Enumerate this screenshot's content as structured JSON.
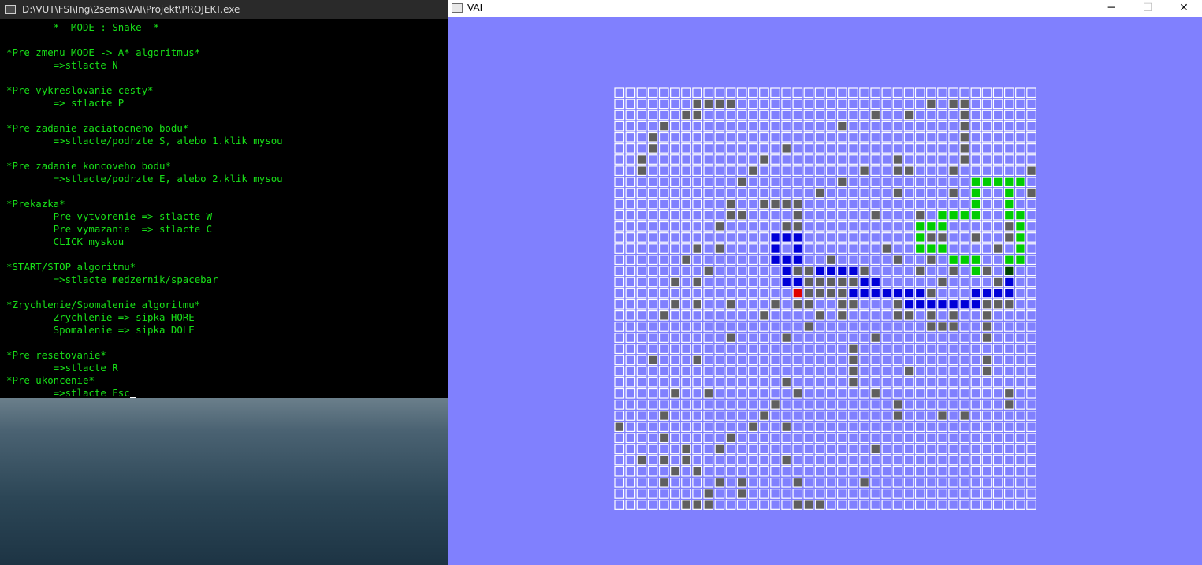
{
  "console": {
    "title": "D:\\VUT\\FSI\\Ing\\2sems\\VAI\\Projekt\\PROJEKT.exe",
    "lines": [
      "        *  MODE : Snake  *",
      "",
      "*Pre zmenu MODE -> A* algoritmus*",
      "        =>stlacte N",
      "",
      "*Pre vykreslovanie cesty*",
      "        => stlacte P",
      "",
      "*Pre zadanie zaciatocneho bodu*",
      "        =>stlacte/podrzte S, alebo 1.klik mysou",
      "",
      "*Pre zadanie koncoveho bodu*",
      "        =>stlacte/podrzte E, alebo 2.klik mysou",
      "",
      "*Prekazka*",
      "        Pre vytvorenie => stlacte W",
      "        Pre vymazanie  => stlacte C",
      "        CLICK myskou",
      "",
      "*START/STOP algoritmu*",
      "        =>stlacte medzernik/spacebar",
      "",
      "*Zrychlenie/Spomalenie algoritmu*",
      "        Zrychlenie => sipka HORE",
      "        Spomalenie => sipka DOLE",
      "",
      "*Pre resetovanie*",
      "        =>stlacte R",
      "*Pre ukoncenie*",
      "        =>stlacte Esc"
    ]
  },
  "vai_window": {
    "title": "VAI",
    "minimize_glyph": "─",
    "maximize_glyph": "☐",
    "close_glyph": "✕"
  },
  "colors": {
    "console_bg": "#000000",
    "console_text": "#18e018",
    "window_bg": "#8080fe",
    "cell_empty": "#8080fe",
    "cell_border": "#ffffff",
    "obstacle": "#5f5f5f",
    "snake_blue": "#0000d8",
    "snake_green": "#00cc00",
    "start": "#e00000",
    "goal": "#004400"
  },
  "grid": {
    "cols": 38,
    "rows": 38,
    "obstacles": [
      [
        1,
        7
      ],
      [
        1,
        8
      ],
      [
        1,
        9
      ],
      [
        1,
        10
      ],
      [
        1,
        28
      ],
      [
        1,
        30
      ],
      [
        1,
        31
      ],
      [
        2,
        6
      ],
      [
        2,
        7
      ],
      [
        2,
        23
      ],
      [
        2,
        26
      ],
      [
        2,
        31
      ],
      [
        3,
        4
      ],
      [
        3,
        20
      ],
      [
        3,
        31
      ],
      [
        4,
        3
      ],
      [
        4,
        31
      ],
      [
        5,
        3
      ],
      [
        5,
        15
      ],
      [
        5,
        31
      ],
      [
        6,
        2
      ],
      [
        6,
        13
      ],
      [
        6,
        25
      ],
      [
        6,
        31
      ],
      [
        7,
        2
      ],
      [
        7,
        12
      ],
      [
        7,
        22
      ],
      [
        7,
        25
      ],
      [
        7,
        26
      ],
      [
        7,
        30
      ],
      [
        7,
        37
      ],
      [
        8,
        11
      ],
      [
        8,
        20
      ],
      [
        9,
        18
      ],
      [
        9,
        25
      ],
      [
        9,
        30
      ],
      [
        9,
        37
      ],
      [
        10,
        10
      ],
      [
        10,
        13
      ],
      [
        10,
        14
      ],
      [
        10,
        15
      ],
      [
        10,
        16
      ],
      [
        11,
        10
      ],
      [
        11,
        11
      ],
      [
        11,
        16
      ],
      [
        11,
        23
      ],
      [
        11,
        27
      ],
      [
        11,
        30
      ],
      [
        12,
        9
      ],
      [
        12,
        15
      ],
      [
        12,
        16
      ],
      [
        12,
        27
      ],
      [
        12,
        28
      ],
      [
        12,
        29
      ],
      [
        12,
        35
      ],
      [
        13,
        27
      ],
      [
        13,
        28
      ],
      [
        13,
        29
      ],
      [
        13,
        32
      ],
      [
        13,
        35
      ],
      [
        14,
        7
      ],
      [
        14,
        9
      ],
      [
        14,
        16
      ],
      [
        14,
        24
      ],
      [
        14,
        29
      ],
      [
        14,
        34
      ],
      [
        15,
        6
      ],
      [
        15,
        15
      ],
      [
        15,
        19
      ],
      [
        15,
        25
      ],
      [
        15,
        28
      ],
      [
        15,
        35
      ],
      [
        16,
        8
      ],
      [
        16,
        16
      ],
      [
        16,
        17
      ],
      [
        16,
        22
      ],
      [
        16,
        27
      ],
      [
        16,
        30
      ],
      [
        16,
        33
      ],
      [
        17,
        5
      ],
      [
        17,
        7
      ],
      [
        17,
        15
      ],
      [
        17,
        17
      ],
      [
        17,
        18
      ],
      [
        17,
        19
      ],
      [
        17,
        20
      ],
      [
        17,
        21
      ],
      [
        17,
        29
      ],
      [
        17,
        34
      ],
      [
        18,
        16
      ],
      [
        18,
        17
      ],
      [
        18,
        18
      ],
      [
        18,
        19
      ],
      [
        18,
        20
      ],
      [
        18,
        28
      ],
      [
        19,
        5
      ],
      [
        19,
        7
      ],
      [
        19,
        10
      ],
      [
        19,
        14
      ],
      [
        19,
        16
      ],
      [
        19,
        17
      ],
      [
        19,
        20
      ],
      [
        19,
        21
      ],
      [
        19,
        25
      ],
      [
        19,
        26
      ],
      [
        19,
        27
      ],
      [
        19,
        29
      ],
      [
        19,
        33
      ],
      [
        19,
        34
      ],
      [
        19,
        35
      ],
      [
        20,
        4
      ],
      [
        20,
        13
      ],
      [
        20,
        18
      ],
      [
        20,
        20
      ],
      [
        20,
        25
      ],
      [
        20,
        26
      ],
      [
        20,
        28
      ],
      [
        20,
        30
      ],
      [
        20,
        33
      ],
      [
        21,
        17
      ],
      [
        21,
        28
      ],
      [
        21,
        29
      ],
      [
        21,
        30
      ],
      [
        21,
        33
      ],
      [
        22,
        10
      ],
      [
        22,
        15
      ],
      [
        22,
        23
      ],
      [
        22,
        33
      ],
      [
        23,
        21
      ],
      [
        24,
        3
      ],
      [
        24,
        7
      ],
      [
        24,
        21
      ],
      [
        24,
        33
      ],
      [
        25,
        21
      ],
      [
        25,
        26
      ],
      [
        25,
        33
      ],
      [
        26,
        15
      ],
      [
        26,
        21
      ],
      [
        27,
        5
      ],
      [
        27,
        8
      ],
      [
        27,
        16
      ],
      [
        27,
        23
      ],
      [
        27,
        35
      ],
      [
        28,
        14
      ],
      [
        28,
        25
      ],
      [
        28,
        35
      ],
      [
        29,
        4
      ],
      [
        29,
        13
      ],
      [
        29,
        25
      ],
      [
        29,
        29
      ],
      [
        29,
        31
      ],
      [
        30,
        0
      ],
      [
        30,
        12
      ],
      [
        30,
        15
      ],
      [
        31,
        4
      ],
      [
        31,
        10
      ],
      [
        32,
        6
      ],
      [
        32,
        9
      ],
      [
        32,
        23
      ],
      [
        33,
        2
      ],
      [
        33,
        4
      ],
      [
        33,
        6
      ],
      [
        33,
        15
      ],
      [
        34,
        5
      ],
      [
        34,
        7
      ],
      [
        35,
        4
      ],
      [
        35,
        9
      ],
      [
        35,
        11
      ],
      [
        35,
        16
      ],
      [
        35,
        22
      ],
      [
        36,
        8
      ],
      [
        36,
        11
      ],
      [
        37,
        16
      ],
      [
        37,
        17
      ],
      [
        37,
        18
      ],
      [
        37,
        6
      ],
      [
        37,
        7
      ],
      [
        37,
        8
      ]
    ],
    "blue_path": [
      [
        13,
        14
      ],
      [
        13,
        15
      ],
      [
        13,
        16
      ],
      [
        14,
        14
      ],
      [
        14,
        16
      ],
      [
        15,
        14
      ],
      [
        15,
        15
      ],
      [
        15,
        16
      ],
      [
        16,
        15
      ],
      [
        16,
        18
      ],
      [
        16,
        19
      ],
      [
        16,
        20
      ],
      [
        16,
        21
      ],
      [
        17,
        15
      ],
      [
        17,
        16
      ],
      [
        17,
        22
      ],
      [
        17,
        23
      ],
      [
        18,
        21
      ],
      [
        18,
        22
      ],
      [
        18,
        23
      ],
      [
        18,
        24
      ],
      [
        18,
        25
      ],
      [
        18,
        26
      ],
      [
        18,
        27
      ],
      [
        19,
        26
      ],
      [
        19,
        27
      ],
      [
        19,
        28
      ],
      [
        19,
        29
      ],
      [
        19,
        30
      ],
      [
        19,
        31
      ],
      [
        19,
        32
      ],
      [
        18,
        32
      ],
      [
        18,
        33
      ],
      [
        18,
        34
      ],
      [
        18,
        35
      ],
      [
        17,
        35
      ]
    ],
    "green_path": [
      [
        8,
        32
      ],
      [
        8,
        33
      ],
      [
        8,
        34
      ],
      [
        8,
        35
      ],
      [
        8,
        36
      ],
      [
        9,
        32
      ],
      [
        9,
        35
      ],
      [
        10,
        32
      ],
      [
        10,
        35
      ],
      [
        11,
        29
      ],
      [
        11,
        30
      ],
      [
        11,
        31
      ],
      [
        11,
        32
      ],
      [
        11,
        35
      ],
      [
        11,
        36
      ],
      [
        12,
        27
      ],
      [
        12,
        28
      ],
      [
        12,
        29
      ],
      [
        12,
        36
      ],
      [
        13,
        27
      ],
      [
        13,
        36
      ],
      [
        14,
        27
      ],
      [
        14,
        28
      ],
      [
        14,
        29
      ],
      [
        14,
        36
      ],
      [
        15,
        30
      ],
      [
        15,
        31
      ],
      [
        15,
        32
      ],
      [
        15,
        35
      ],
      [
        15,
        36
      ],
      [
        16,
        32
      ]
    ],
    "start": [
      18,
      16
    ],
    "goal": [
      16,
      35
    ]
  }
}
